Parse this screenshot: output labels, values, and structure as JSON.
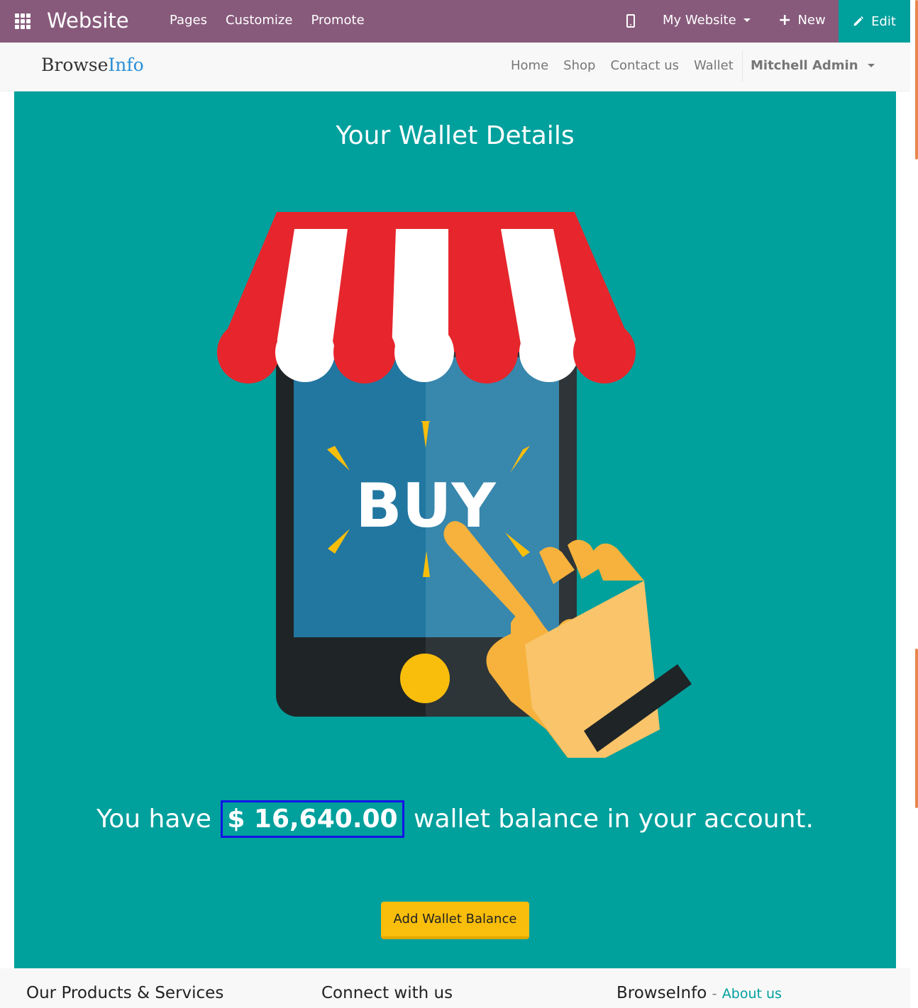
{
  "topbar": {
    "brand": "Website",
    "menu": [
      "Pages",
      "Customize",
      "Promote"
    ],
    "website_select": "My Website",
    "new_label": "New",
    "edit_label": "Edit",
    "bg_color": "#875A7B",
    "edit_color": "#00A09D"
  },
  "site_header": {
    "logo_part1": "Browse",
    "logo_part2": "Info",
    "nav": [
      "Home",
      "Shop",
      "Contact us",
      "Wallet"
    ],
    "user": "Mitchell Admin"
  },
  "wallet": {
    "title": "Your Wallet Details",
    "illustration_text": "BUY",
    "balance_prefix": "You have",
    "balance_amount": "$ 16,640.00",
    "balance_suffix": "wallet balance in your account.",
    "add_button": "Add Wallet Balance",
    "panel_color": "#00A09D",
    "button_color": "#F9BE0B"
  },
  "footer": {
    "col1": "Our Products & Services",
    "col2": "Connect with us",
    "col3_title": "BrowseInfo",
    "col3_sep": "-",
    "col3_link": "About us"
  }
}
